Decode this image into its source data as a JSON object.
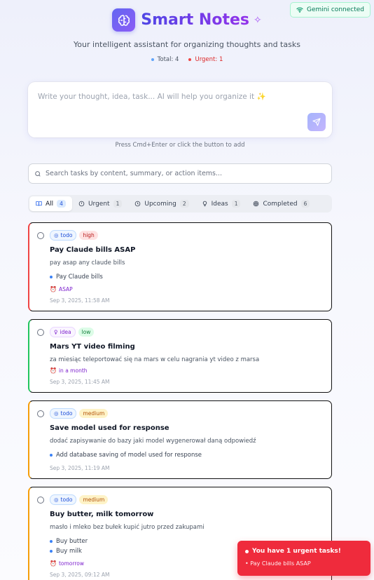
{
  "status": {
    "gemini": "Gemini connected"
  },
  "header": {
    "title": "Smart Notes",
    "tagline": "Your intelligent assistant for organizing thoughts and tasks",
    "stats": {
      "total": "Total: 4",
      "urgent": "Urgent: 1"
    }
  },
  "compose": {
    "placeholder": "Write your thought, idea, task... AI will help you organize it ✨",
    "hint": "Press Cmd+Enter or click the button to add"
  },
  "search": {
    "placeholder": "Search tasks by content, summary, or action items..."
  },
  "tabs": [
    {
      "label": "All",
      "count": "4",
      "icon": "book-icon"
    },
    {
      "label": "Urgent",
      "count": "1",
      "icon": "alert-circle-icon"
    },
    {
      "label": "Upcoming",
      "count": "2",
      "icon": "clock-icon"
    },
    {
      "label": "Ideas",
      "count": "1",
      "icon": "lightbulb-icon"
    },
    {
      "label": "Completed",
      "count": "6",
      "icon": "target-icon"
    }
  ],
  "cards": [
    {
      "type": "todo",
      "priority": "high",
      "title": "Pay Claude bills ASAP",
      "description": "pay asap any claude bills",
      "actions": [
        "Pay Claude bills"
      ],
      "due": "ASAP",
      "timestamp": "Sep 3, 2025, 11:58 AM"
    },
    {
      "type": "idea",
      "priority": "low",
      "title": "Mars YT video filming",
      "description": "za miesiąc teleportować się na mars w celu nagrania yt video z marsa",
      "actions": [],
      "due": "in a month",
      "timestamp": "Sep 3, 2025, 11:45 AM"
    },
    {
      "type": "todo",
      "priority": "medium",
      "title": "Save model used for response",
      "description": "dodać zapisywanie do bazy jaki model wygenerował daną odpowiedź",
      "actions": [
        "Add database saving of model used for response"
      ],
      "due": "",
      "timestamp": "Sep 3, 2025, 11:19 AM"
    },
    {
      "type": "todo",
      "priority": "medium",
      "title": "Buy butter, milk tomorrow",
      "description": "masło i mleko bez bułek kupić jutro przed zakupami",
      "actions": [
        "Buy butter",
        "Buy milk"
      ],
      "due": "tomorrow",
      "timestamp": "Sep 3, 2025, 09:12 AM"
    }
  ],
  "toast": {
    "title": "You have 1 urgent tasks!",
    "item": "• Pay Claude bills ASAP"
  },
  "colors": {
    "accent": "#6366f1",
    "urgent": "#ef4444",
    "low": "#22c55e",
    "medium": "#f59e0b",
    "toast": "#ef2b3c"
  }
}
